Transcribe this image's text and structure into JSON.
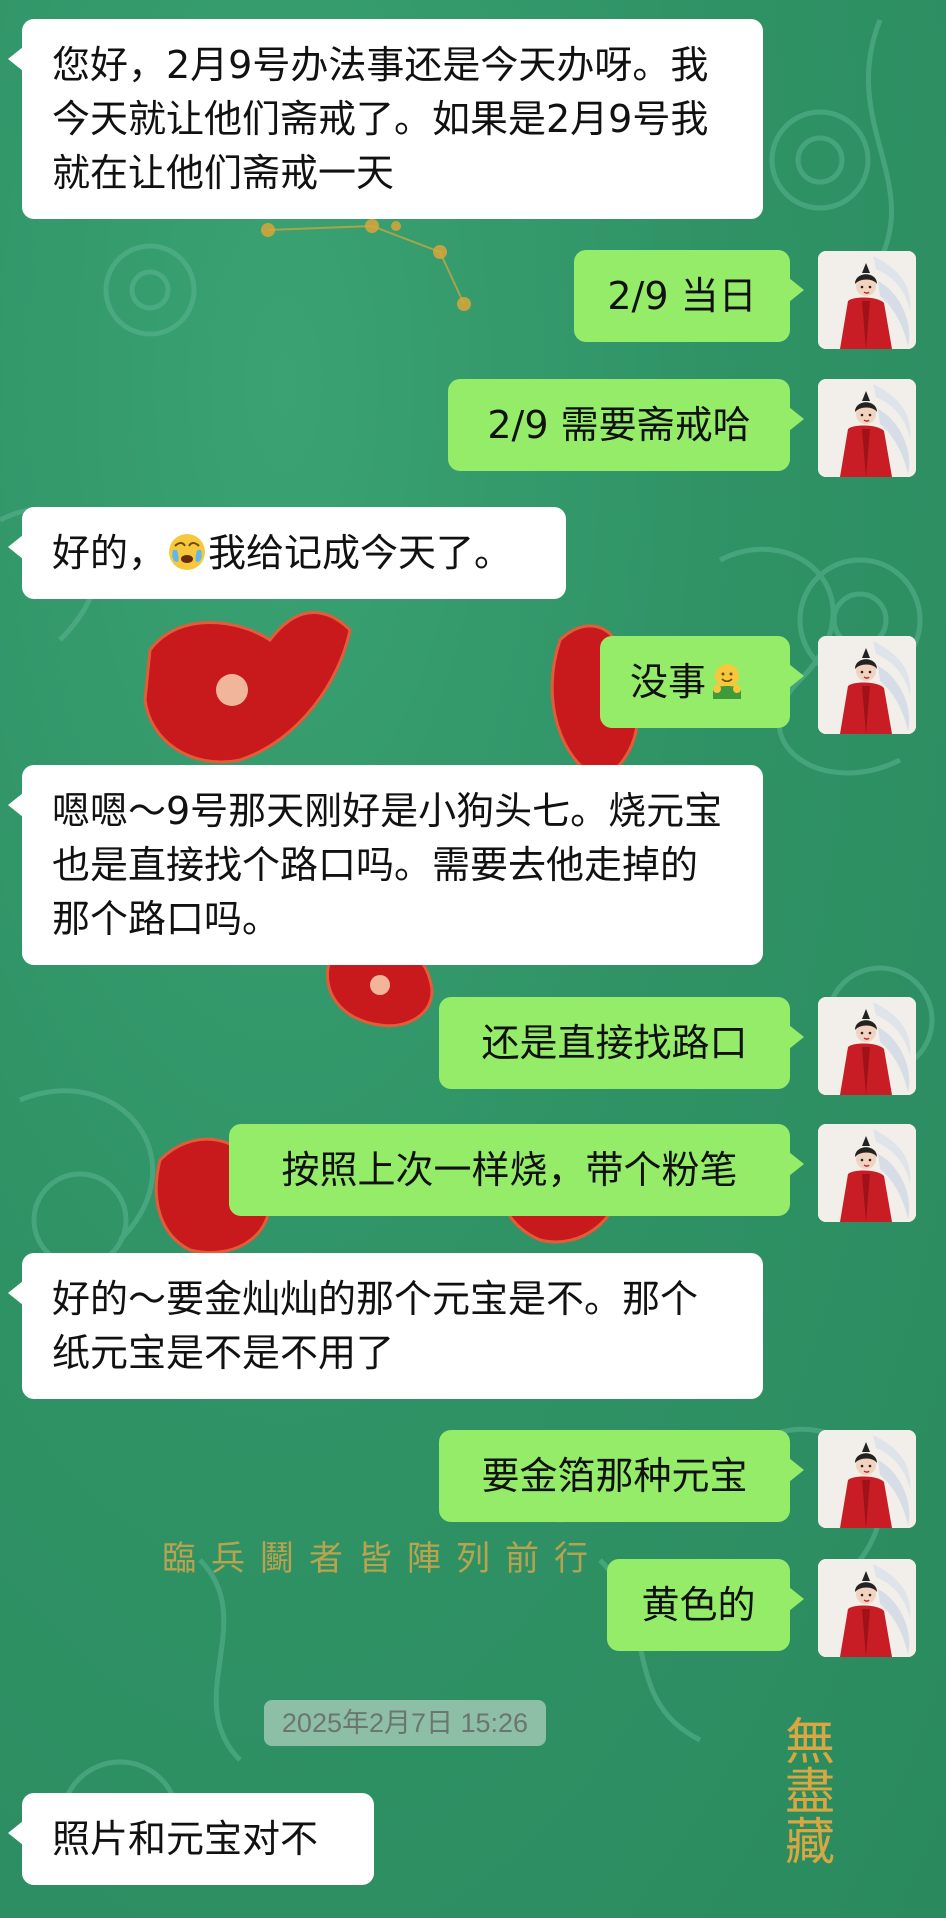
{
  "messages": [
    {
      "side": "in",
      "text": "您好，2月9号办法事还是今天办呀。我今天就让他们斋戒了。如果是2月9号我就在让他们斋戒一天"
    },
    {
      "side": "out",
      "text": "2/9 当日"
    },
    {
      "side": "out",
      "text": "2/9 需要斋戒哈"
    },
    {
      "side": "in",
      "text_before": "好的，",
      "emoji": "crying-face-emoji",
      "text_after": "我给记成今天了。"
    },
    {
      "side": "out",
      "text_before": "没事",
      "emoji": "hug-emoji"
    },
    {
      "side": "in",
      "text": "嗯嗯～9号那天刚好是小狗头七。烧元宝也是直接找个路口吗。需要去他走掉的那个路口吗。"
    },
    {
      "side": "out",
      "text": "还是直接找路口"
    },
    {
      "side": "out",
      "text": "按照上次一样烧，带个粉笔"
    },
    {
      "side": "in",
      "text": "好的～要金灿灿的那个元宝是不。那个纸元宝是不是不用了"
    },
    {
      "side": "out",
      "text": "要金箔那种元宝"
    },
    {
      "side": "out",
      "text": "黄色的"
    }
  ],
  "timestamp": "2025年2月7日 15:26",
  "last_message": {
    "side": "in",
    "text": "照片和元宝对不"
  },
  "background": {
    "poem_text": "臨兵鬬者皆陣列前行",
    "calligraphy": "無盡藏"
  },
  "colors": {
    "background": "#2f9366",
    "incoming_bubble": "#ffffff",
    "outgoing_bubble": "#95ec69",
    "text": "#111111",
    "timestamp_text": "#6c7570"
  },
  "avatar": {
    "icon": "avatar-woman-red-robe"
  }
}
